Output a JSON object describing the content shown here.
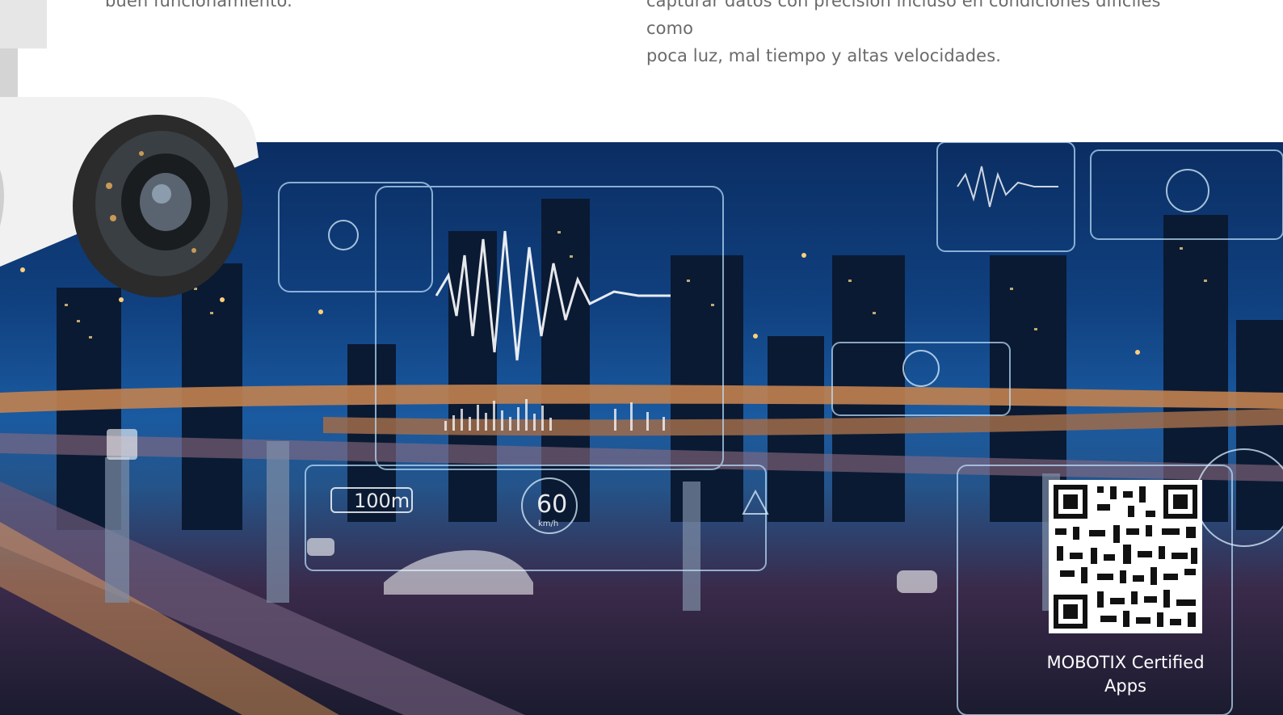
{
  "paragraphs": {
    "left": "buen funcionamiento.",
    "right_line1": "capturar datos con precisión incluso en condiciones difíciles como",
    "right_line2": "poca luz, mal tiempo y altas velocidades."
  },
  "hud": {
    "distance_sign": "100m",
    "speed_value": "60",
    "speed_unit": "km/h"
  },
  "qr": {
    "caption": "MOBOTIX Certified Apps"
  },
  "colors": {
    "body_text": "#6a6a6a",
    "night_sky": "#10407f",
    "road_glow": "#f2a65a"
  }
}
